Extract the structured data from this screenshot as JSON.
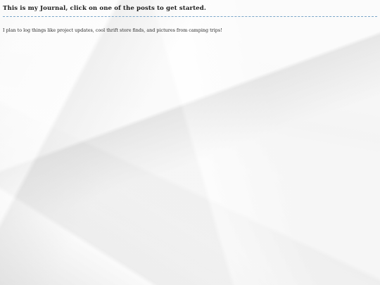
{
  "journal": {
    "title": "This is my Journal, click on one of the posts to get started.",
    "intro": "I plan to log things like project updates, cool thrift store finds, and pictures from camping trips!"
  },
  "colors": {
    "divider": "#7aa6c9",
    "text": "#1a1a1a",
    "background": "#f0f0f0"
  }
}
